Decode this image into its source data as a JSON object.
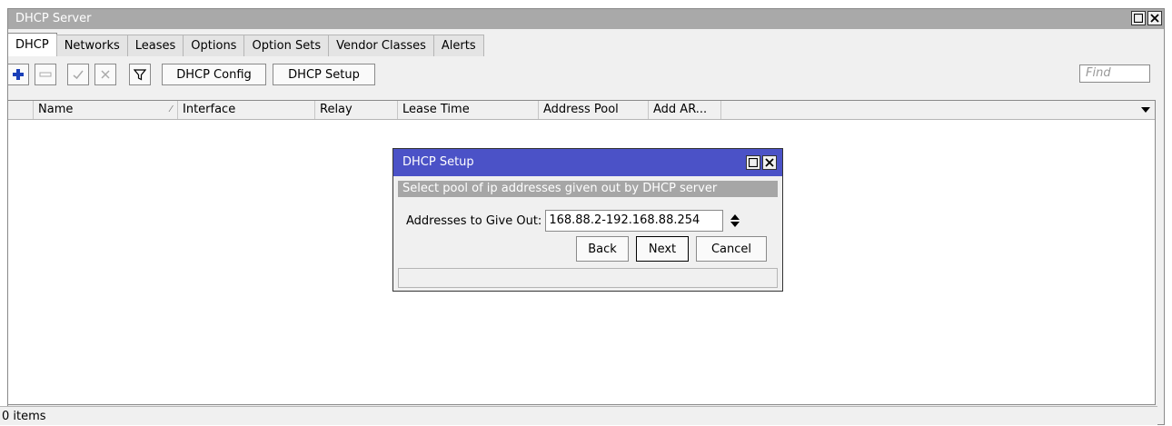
{
  "window": {
    "title": "DHCP Server"
  },
  "tabs": [
    {
      "label": "DHCP",
      "active": true
    },
    {
      "label": "Networks"
    },
    {
      "label": "Leases"
    },
    {
      "label": "Options"
    },
    {
      "label": "Option Sets"
    },
    {
      "label": "Vendor Classes"
    },
    {
      "label": "Alerts"
    }
  ],
  "toolbar": {
    "add_icon": "plus-icon",
    "remove_icon": "minus-icon",
    "enable_icon": "check-icon",
    "disable_icon": "cross-icon",
    "filter_icon": "filter-icon",
    "dhcp_config_label": "DHCP Config",
    "dhcp_setup_label": "DHCP Setup",
    "find_placeholder": "Find"
  },
  "table": {
    "columns": [
      "Name",
      "Interface",
      "Relay",
      "Lease Time",
      "Address Pool",
      "Add AR..."
    ],
    "sort_column": "Name"
  },
  "status": {
    "items_text": "0 items"
  },
  "dialog": {
    "title": "DHCP Setup",
    "subtitle": "Select pool of ip addresses given out by DHCP server",
    "field_label": "Addresses to Give Out:",
    "field_value": "168.88.2-192.168.88.254",
    "back_label": "Back",
    "next_label": "Next",
    "cancel_label": "Cancel"
  },
  "colors": {
    "dialog_title_bg": "#4b52c7",
    "titlebar_bg": "#a9a9a9",
    "add_icon_color": "#1a3fb8"
  }
}
